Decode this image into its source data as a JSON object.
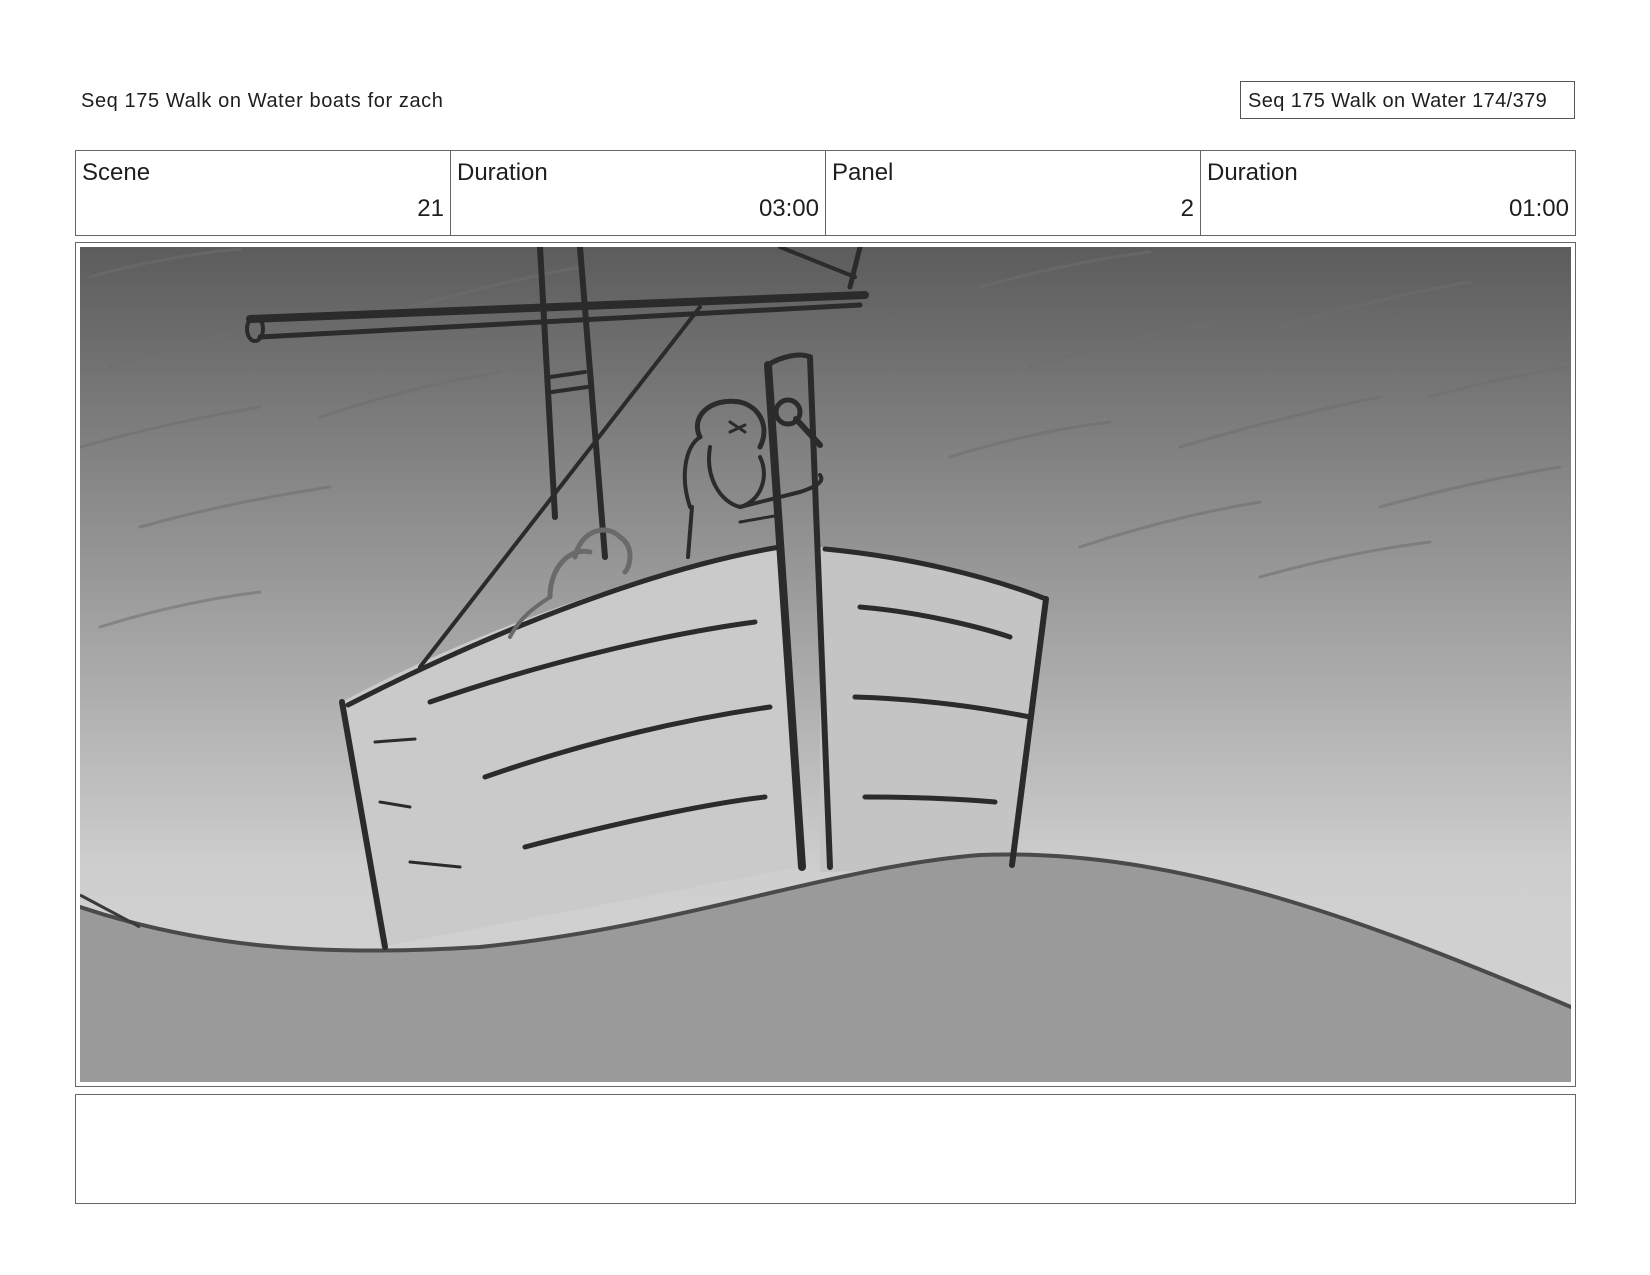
{
  "header": {
    "title": "Seq 175 Walk on Water  boats for zach",
    "page_label": "Seq 175 Walk on Water 174/379"
  },
  "info": {
    "scene_label": "Scene",
    "scene_value": "21",
    "scene_duration_label": "Duration",
    "scene_duration_value": "03:00",
    "panel_label": "Panel",
    "panel_value": "2",
    "panel_duration_label": "Duration",
    "panel_duration_value": "01:00"
  },
  "panel": {
    "illustration": "storyboard-sketch-boat-in-storm",
    "colors": {
      "sky_top": "#5c5c5c",
      "sky_bottom": "#cfcfcf",
      "hull": "#cacaca",
      "sea": "#9a9a9a",
      "ink": "#2b2b2b"
    }
  },
  "notes": {
    "text": ""
  }
}
